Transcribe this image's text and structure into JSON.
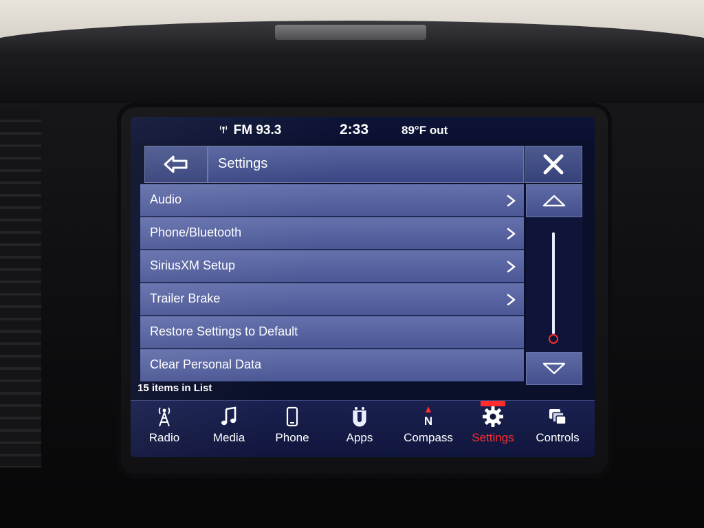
{
  "status": {
    "radio": "FM 93.3",
    "time": "2:33",
    "temperature": "89°F out"
  },
  "header": {
    "title": "Settings"
  },
  "list": {
    "items": [
      {
        "label": "Audio",
        "has_chevron": true
      },
      {
        "label": "Phone/Bluetooth",
        "has_chevron": true
      },
      {
        "label": "SiriusXM Setup",
        "has_chevron": true
      },
      {
        "label": "Trailer Brake",
        "has_chevron": true
      },
      {
        "label": "Restore Settings to Default",
        "has_chevron": false
      },
      {
        "label": "Clear Personal Data",
        "has_chevron": false
      }
    ],
    "count_text": "15 items in List",
    "scroll_position": 1.0
  },
  "nav": {
    "items": [
      {
        "label": "Radio",
        "icon": "radio-tower-icon"
      },
      {
        "label": "Media",
        "icon": "music-note-icon"
      },
      {
        "label": "Phone",
        "icon": "phone-icon"
      },
      {
        "label": "Apps",
        "icon": "apps-icon"
      },
      {
        "label": "Compass",
        "icon": "compass-icon"
      },
      {
        "label": "Settings",
        "icon": "gear-icon",
        "active": true
      },
      {
        "label": "Controls",
        "icon": "controls-icon"
      }
    ]
  },
  "colors": {
    "accent_active": "#ff2d2d",
    "list_item": "#5864a2",
    "background": "#0a0f2a"
  }
}
